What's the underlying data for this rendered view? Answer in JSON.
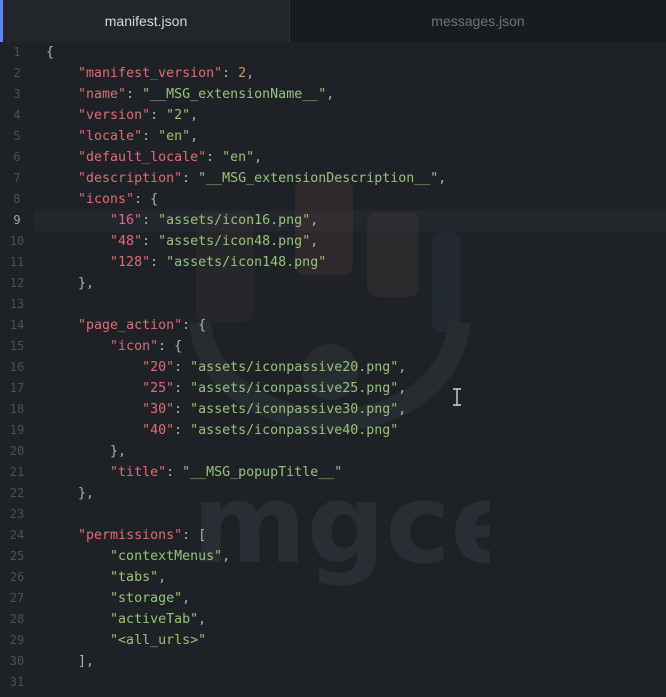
{
  "tabs": [
    {
      "label": "manifest.json",
      "active": true
    },
    {
      "label": "messages.json",
      "active": false
    }
  ],
  "current_line": 9,
  "colors": {
    "background": "#1e2227",
    "key": "#e06c75",
    "string": "#98c379",
    "number": "#d19a66",
    "punctuation": "#abb2bf",
    "tab_accent": "#568af2"
  },
  "watermark_text": "mgce",
  "lines": [
    {
      "n": "1",
      "tokens": [
        {
          "t": "p",
          "v": "{"
        }
      ]
    },
    {
      "n": "2",
      "tokens": [
        {
          "t": "p",
          "v": "    "
        },
        {
          "t": "k",
          "v": "\"manifest_version\""
        },
        {
          "t": "p",
          "v": ": "
        },
        {
          "t": "n",
          "v": "2"
        },
        {
          "t": "p",
          "v": ","
        }
      ]
    },
    {
      "n": "3",
      "tokens": [
        {
          "t": "p",
          "v": "    "
        },
        {
          "t": "k",
          "v": "\"name\""
        },
        {
          "t": "p",
          "v": ": "
        },
        {
          "t": "s",
          "v": "\"__MSG_extensionName__\""
        },
        {
          "t": "p",
          "v": ","
        }
      ]
    },
    {
      "n": "4",
      "tokens": [
        {
          "t": "p",
          "v": "    "
        },
        {
          "t": "k",
          "v": "\"version\""
        },
        {
          "t": "p",
          "v": ": "
        },
        {
          "t": "s",
          "v": "\"2\""
        },
        {
          "t": "p",
          "v": ","
        }
      ]
    },
    {
      "n": "5",
      "tokens": [
        {
          "t": "p",
          "v": "    "
        },
        {
          "t": "k",
          "v": "\"locale\""
        },
        {
          "t": "p",
          "v": ": "
        },
        {
          "t": "s",
          "v": "\"en\""
        },
        {
          "t": "p",
          "v": ","
        }
      ]
    },
    {
      "n": "6",
      "tokens": [
        {
          "t": "p",
          "v": "    "
        },
        {
          "t": "k",
          "v": "\"default_locale\""
        },
        {
          "t": "p",
          "v": ": "
        },
        {
          "t": "s",
          "v": "\"en\""
        },
        {
          "t": "p",
          "v": ","
        }
      ]
    },
    {
      "n": "7",
      "tokens": [
        {
          "t": "p",
          "v": "    "
        },
        {
          "t": "k",
          "v": "\"description\""
        },
        {
          "t": "p",
          "v": ": "
        },
        {
          "t": "s",
          "v": "\"__MSG_extensionDescription__\""
        },
        {
          "t": "p",
          "v": ","
        }
      ]
    },
    {
      "n": "8",
      "tokens": [
        {
          "t": "p",
          "v": "    "
        },
        {
          "t": "k",
          "v": "\"icons\""
        },
        {
          "t": "p",
          "v": ": {"
        }
      ]
    },
    {
      "n": "9",
      "tokens": [
        {
          "t": "p",
          "v": "        "
        },
        {
          "t": "k",
          "v": "\"16\""
        },
        {
          "t": "p",
          "v": ": "
        },
        {
          "t": "s",
          "v": "\"assets/icon16.png\""
        },
        {
          "t": "p",
          "v": ","
        }
      ]
    },
    {
      "n": "10",
      "tokens": [
        {
          "t": "p",
          "v": "        "
        },
        {
          "t": "k",
          "v": "\"48\""
        },
        {
          "t": "p",
          "v": ": "
        },
        {
          "t": "s",
          "v": "\"assets/icon48.png\""
        },
        {
          "t": "p",
          "v": ","
        }
      ]
    },
    {
      "n": "11",
      "tokens": [
        {
          "t": "p",
          "v": "        "
        },
        {
          "t": "k",
          "v": "\"128\""
        },
        {
          "t": "p",
          "v": ": "
        },
        {
          "t": "s",
          "v": "\"assets/icon148.png\""
        }
      ]
    },
    {
      "n": "12",
      "tokens": [
        {
          "t": "p",
          "v": "    },"
        }
      ]
    },
    {
      "n": "13",
      "tokens": []
    },
    {
      "n": "14",
      "tokens": [
        {
          "t": "p",
          "v": "    "
        },
        {
          "t": "k",
          "v": "\"page_action\""
        },
        {
          "t": "p",
          "v": ": {"
        }
      ]
    },
    {
      "n": "15",
      "tokens": [
        {
          "t": "p",
          "v": "        "
        },
        {
          "t": "k",
          "v": "\"icon\""
        },
        {
          "t": "p",
          "v": ": {"
        }
      ]
    },
    {
      "n": "16",
      "tokens": [
        {
          "t": "p",
          "v": "            "
        },
        {
          "t": "k",
          "v": "\"20\""
        },
        {
          "t": "p",
          "v": ": "
        },
        {
          "t": "s",
          "v": "\"assets/iconpassive20.png\""
        },
        {
          "t": "p",
          "v": ","
        }
      ]
    },
    {
      "n": "17",
      "tokens": [
        {
          "t": "p",
          "v": "            "
        },
        {
          "t": "k",
          "v": "\"25\""
        },
        {
          "t": "p",
          "v": ": "
        },
        {
          "t": "s",
          "v": "\"assets/iconpassive25.png\""
        },
        {
          "t": "p",
          "v": ","
        }
      ]
    },
    {
      "n": "18",
      "tokens": [
        {
          "t": "p",
          "v": "            "
        },
        {
          "t": "k",
          "v": "\"30\""
        },
        {
          "t": "p",
          "v": ": "
        },
        {
          "t": "s",
          "v": "\"assets/iconpassive30.png\""
        },
        {
          "t": "p",
          "v": ","
        }
      ]
    },
    {
      "n": "19",
      "tokens": [
        {
          "t": "p",
          "v": "            "
        },
        {
          "t": "k",
          "v": "\"40\""
        },
        {
          "t": "p",
          "v": ": "
        },
        {
          "t": "s",
          "v": "\"assets/iconpassive40.png\""
        }
      ]
    },
    {
      "n": "20",
      "tokens": [
        {
          "t": "p",
          "v": "        },"
        }
      ]
    },
    {
      "n": "21",
      "tokens": [
        {
          "t": "p",
          "v": "        "
        },
        {
          "t": "k",
          "v": "\"title\""
        },
        {
          "t": "p",
          "v": ": "
        },
        {
          "t": "s",
          "v": "\"__MSG_popupTitle__\""
        }
      ]
    },
    {
      "n": "22",
      "tokens": [
        {
          "t": "p",
          "v": "    },"
        }
      ]
    },
    {
      "n": "23",
      "tokens": []
    },
    {
      "n": "24",
      "tokens": [
        {
          "t": "p",
          "v": "    "
        },
        {
          "t": "k",
          "v": "\"permissions\""
        },
        {
          "t": "p",
          "v": ": ["
        }
      ]
    },
    {
      "n": "25",
      "tokens": [
        {
          "t": "p",
          "v": "        "
        },
        {
          "t": "s",
          "v": "\"contextMenus\""
        },
        {
          "t": "p",
          "v": ","
        }
      ]
    },
    {
      "n": "26",
      "tokens": [
        {
          "t": "p",
          "v": "        "
        },
        {
          "t": "s",
          "v": "\"tabs\""
        },
        {
          "t": "p",
          "v": ","
        }
      ]
    },
    {
      "n": "27",
      "tokens": [
        {
          "t": "p",
          "v": "        "
        },
        {
          "t": "s",
          "v": "\"storage\""
        },
        {
          "t": "p",
          "v": ","
        }
      ]
    },
    {
      "n": "28",
      "tokens": [
        {
          "t": "p",
          "v": "        "
        },
        {
          "t": "s",
          "v": "\"activeTab\""
        },
        {
          "t": "p",
          "v": ","
        }
      ]
    },
    {
      "n": "29",
      "tokens": [
        {
          "t": "p",
          "v": "        "
        },
        {
          "t": "s",
          "v": "\"<all_urls>\""
        }
      ]
    },
    {
      "n": "30",
      "tokens": [
        {
          "t": "p",
          "v": "    ],"
        }
      ]
    },
    {
      "n": "31",
      "tokens": []
    }
  ]
}
